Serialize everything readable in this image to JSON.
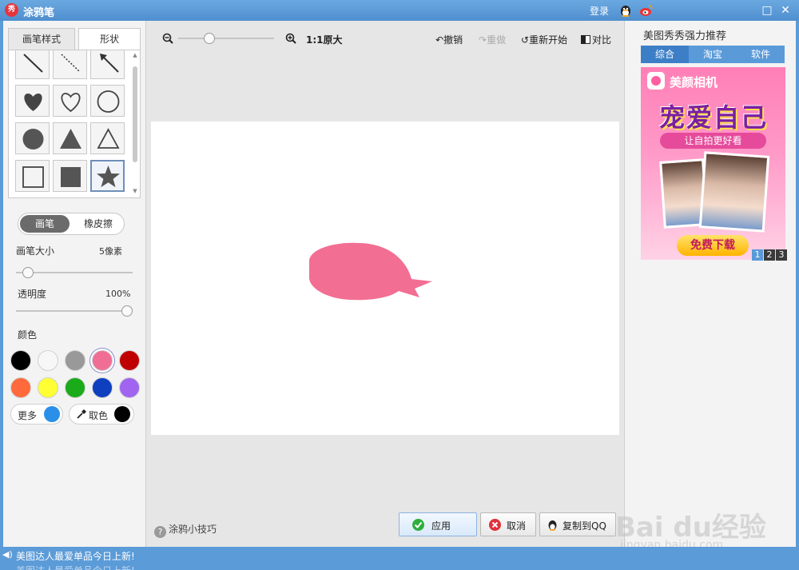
{
  "window": {
    "app_title": "涂鸦笔",
    "logo_text": "秀",
    "login_label": "登录",
    "maximize_glyph": "□",
    "close_glyph": "✕"
  },
  "left_panel": {
    "tabs": [
      {
        "label": "画笔样式",
        "active": false
      },
      {
        "label": "形状",
        "active": true
      }
    ],
    "shapes": [
      "line",
      "dashed-line",
      "arrow",
      "heart-filled",
      "heart-outline",
      "circle-outline",
      "circle-filled",
      "triangle-filled",
      "triangle-outline",
      "square-outline",
      "square-filled",
      "star-filled"
    ],
    "selected_shape": "star-filled",
    "mode_toggle": {
      "pen": "画笔",
      "eraser": "橡皮擦",
      "active": "pen"
    },
    "brush_size": {
      "label": "画笔大小",
      "value_text": "5像素",
      "fraction": 0.06
    },
    "opacity": {
      "label": "透明度",
      "value_text": "100%",
      "fraction": 1.0
    },
    "color_label": "颜色",
    "colors": [
      "#000000",
      "#f7f7f7",
      "#999999",
      "#f06e95",
      "#c00000",
      "#ff6a3c",
      "#ffff33",
      "#1aaa1a",
      "#0d3fbf",
      "#a064f0"
    ],
    "selected_color": "#f06e95",
    "more_label": "更多",
    "more_color": "#2a8fe8",
    "pick_label": "取色",
    "pick_color": "#000000"
  },
  "toolbar": {
    "zoom_fraction": 0.3,
    "ratio_label": "1:1",
    "original_label": "原大",
    "undo": "撤销",
    "redo": "重做",
    "restart": "重新开始",
    "compare": "对比"
  },
  "canvas": {
    "drawing_color": "#f26e93"
  },
  "footer": {
    "tips": "涂鸦小技巧",
    "apply": "应用",
    "cancel": "取消",
    "copy_qq": "复制到QQ"
  },
  "right_panel": {
    "title": "美图秀秀强力推荐",
    "tabs": [
      {
        "label": "综合",
        "active": true
      },
      {
        "label": "淘宝",
        "active": false
      },
      {
        "label": "软件",
        "active": false
      }
    ],
    "ad": {
      "app_name": "美颜相机",
      "headline": "宠爱自己",
      "subline": "让自拍更好看",
      "download": "免费下载",
      "pages": [
        "1",
        "2",
        "3"
      ],
      "active_page": "1"
    }
  },
  "status_bar": {
    "message": "美图达人最爱单品今日上新!",
    "message_next": "美图达人最爱单品今日上新!"
  },
  "watermark": {
    "brand": "Bai du经验",
    "url": "jingyan.baidu.com"
  }
}
